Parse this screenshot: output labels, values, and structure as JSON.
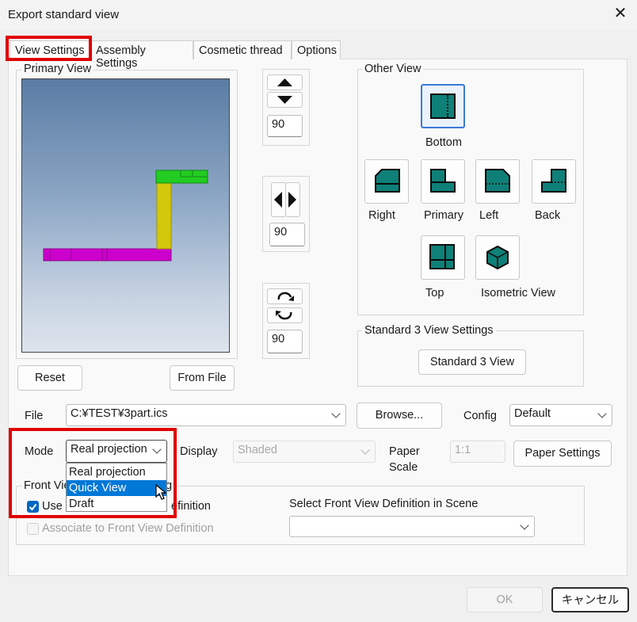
{
  "window": {
    "title": "Export standard view",
    "close_glyph": "✕"
  },
  "tabs": [
    {
      "label": "View Settings",
      "active": true
    },
    {
      "label": "Assembly Settings"
    },
    {
      "label": "Cosmetic thread"
    },
    {
      "label": "Options"
    }
  ],
  "primary_view": {
    "label": "Primary View",
    "reset_label": "Reset",
    "from_file_label": "From File"
  },
  "rotation": {
    "vertical_value": "90",
    "horizontal_value": "90",
    "roll_value": "90"
  },
  "other_view": {
    "label": "Other View",
    "views": {
      "bottom": "Bottom",
      "right": "Right",
      "primary": "Primary",
      "left": "Left",
      "back": "Back",
      "top": "Top",
      "isometric": "Isometric View"
    }
  },
  "standard3": {
    "label": "Standard 3 View Settings",
    "button": "Standard 3 View"
  },
  "file": {
    "label": "File",
    "value": "C:¥TEST¥3part.ics",
    "browse": "Browse...",
    "config_label": "Config",
    "config_value": "Default"
  },
  "mode": {
    "label": "Mode",
    "value": "Real projection",
    "options": [
      "Real projection",
      "Quick View",
      "Draft"
    ],
    "highlighted": "Quick View"
  },
  "display": {
    "label": "Display",
    "value": "Shaded"
  },
  "paper": {
    "label_line1": "Paper",
    "label_line2": "Scale",
    "value": "1:1",
    "settings_button": "Paper Settings"
  },
  "front_view": {
    "group_label_left": "Front Vie",
    "group_label_right": "g",
    "use_label_left": "Use",
    "use_label_right": "efinition",
    "associate_label": "Associate to Front View Definition",
    "select_label": "Select Front View Definition in Scene",
    "select_value": ""
  },
  "footer": {
    "ok": "OK",
    "cancel": "キャンセル"
  },
  "colors": {
    "accent": "#0078d7",
    "highlight_box": "#e00000",
    "teal": "#0e8078",
    "model_magenta": "#cc00cc",
    "model_yellow": "#d4c80c",
    "model_green": "#22cc22"
  }
}
